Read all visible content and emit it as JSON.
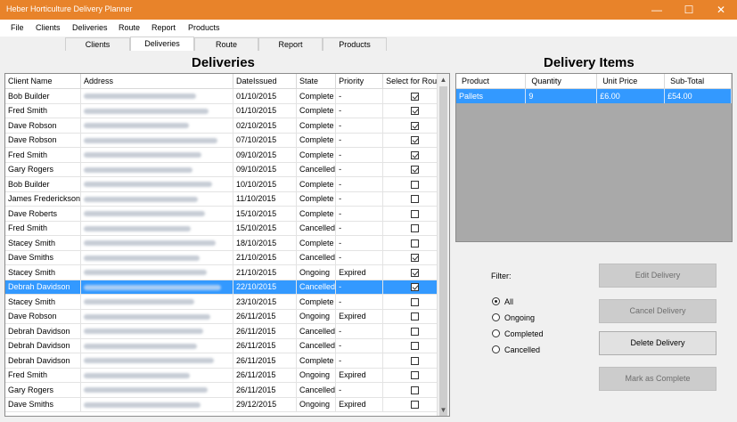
{
  "window": {
    "title": "Heber Horticulture Delivery Planner"
  },
  "menu": [
    "File",
    "Clients",
    "Deliveries",
    "Route",
    "Report",
    "Products"
  ],
  "tabs": [
    "Clients",
    "Deliveries",
    "Route",
    "Report",
    "Products"
  ],
  "active_tab": "Deliveries",
  "deliveries": {
    "heading": "Deliveries",
    "columns": [
      "Client Name",
      "Address",
      "DateIssued",
      "State",
      "Priority",
      "Select for Route"
    ],
    "rows": [
      {
        "client": "Bob Builder",
        "date": "01/10/2015",
        "state": "Complete",
        "priority": "-",
        "selected": true
      },
      {
        "client": "Fred Smith",
        "date": "01/10/2015",
        "state": "Complete",
        "priority": "-",
        "selected": true
      },
      {
        "client": "Dave Robson",
        "date": "02/10/2015",
        "state": "Complete",
        "priority": "-",
        "selected": true
      },
      {
        "client": "Dave Robson",
        "date": "07/10/2015",
        "state": "Complete",
        "priority": "-",
        "selected": true
      },
      {
        "client": "Fred Smith",
        "date": "09/10/2015",
        "state": "Complete",
        "priority": "-",
        "selected": true
      },
      {
        "client": "Gary Rogers",
        "date": "09/10/2015",
        "state": "Cancelled",
        "priority": "-",
        "selected": true
      },
      {
        "client": "Bob Builder",
        "date": "10/10/2015",
        "state": "Complete",
        "priority": "-",
        "selected": false
      },
      {
        "client": "James Frederickson",
        "date": "11/10/2015",
        "state": "Complete",
        "priority": "-",
        "selected": false
      },
      {
        "client": "Dave Roberts",
        "date": "15/10/2015",
        "state": "Complete",
        "priority": "-",
        "selected": false
      },
      {
        "client": "Fred Smith",
        "date": "15/10/2015",
        "state": "Cancelled",
        "priority": "-",
        "selected": false
      },
      {
        "client": "Stacey Smith",
        "date": "18/10/2015",
        "state": "Complete",
        "priority": "-",
        "selected": false
      },
      {
        "client": "Dave Smiths",
        "date": "21/10/2015",
        "state": "Cancelled",
        "priority": "-",
        "selected": true
      },
      {
        "client": "Stacey Smith",
        "date": "21/10/2015",
        "state": "Ongoing",
        "priority": "Expired",
        "selected": true
      },
      {
        "client": "Debrah Davidson",
        "date": "22/10/2015",
        "state": "Cancelled",
        "priority": "-",
        "selected": true,
        "highlighted": true
      },
      {
        "client": "Stacey Smith",
        "date": "23/10/2015",
        "state": "Complete",
        "priority": "-",
        "selected": false
      },
      {
        "client": "Dave Robson",
        "date": "26/11/2015",
        "state": "Ongoing",
        "priority": "Expired",
        "selected": false
      },
      {
        "client": "Debrah Davidson",
        "date": "26/11/2015",
        "state": "Cancelled",
        "priority": "-",
        "selected": false
      },
      {
        "client": "Debrah Davidson",
        "date": "26/11/2015",
        "state": "Cancelled",
        "priority": "-",
        "selected": false
      },
      {
        "client": "Debrah Davidson",
        "date": "26/11/2015",
        "state": "Complete",
        "priority": "-",
        "selected": false
      },
      {
        "client": "Fred Smith",
        "date": "26/11/2015",
        "state": "Ongoing",
        "priority": "Expired",
        "selected": false
      },
      {
        "client": "Gary Rogers",
        "date": "26/11/2015",
        "state": "Cancelled",
        "priority": "-",
        "selected": false
      },
      {
        "client": "Dave Smiths",
        "date": "29/12/2015",
        "state": "Ongoing",
        "priority": "Expired",
        "selected": false
      }
    ]
  },
  "items": {
    "heading": "Delivery Items",
    "columns": [
      "Product",
      "Quantity",
      "Unit Price",
      "Sub-Total"
    ],
    "rows": [
      {
        "product": "Pallets",
        "quantity": "9",
        "unit_price": "£6.00",
        "subtotal": "£54.00"
      }
    ]
  },
  "filter": {
    "label": "Filter:",
    "options": [
      "All",
      "Ongoing",
      "Completed",
      "Cancelled"
    ],
    "selected": "All"
  },
  "buttons": {
    "edit": "Edit Delivery",
    "cancel": "Cancel Delivery",
    "delete": "Delete Delivery",
    "complete": "Mark as Complete"
  },
  "colors": {
    "titlebar": "#e8832a",
    "selection": "#3399ff",
    "disabled_button": "#cccccc"
  },
  "icons": [
    "minimize-icon",
    "maximize-icon",
    "close-icon",
    "checkbox-icon",
    "scroll-up-icon",
    "scroll-down-icon"
  ]
}
